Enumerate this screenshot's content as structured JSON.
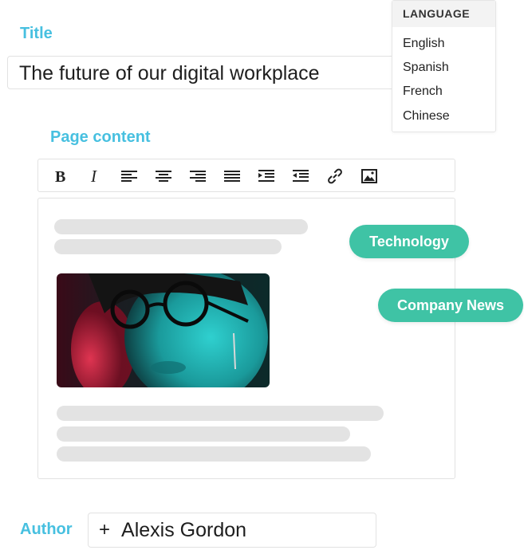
{
  "form": {
    "title_label": "Title",
    "title_value": "The future of our digital workplace",
    "content_label": "Page content",
    "author_label": "Author",
    "author_plus": "+",
    "author_value": "Alexis Gordon"
  },
  "toolbar": {
    "icons": [
      "bold-icon",
      "italic-icon",
      "align-left-icon",
      "align-center-icon",
      "align-right-icon",
      "align-justify-icon",
      "indent-icon",
      "outdent-icon",
      "link-icon",
      "image-icon"
    ]
  },
  "tags": [
    "Technology",
    "Company News"
  ],
  "language_menu": {
    "header": "LANGUAGE",
    "options": [
      "English",
      "Spanish",
      "French",
      "Chinese"
    ]
  },
  "colors": {
    "label": "#47c0e0",
    "tag": "#3fc3a5",
    "skeleton": "#e3e3e3"
  }
}
